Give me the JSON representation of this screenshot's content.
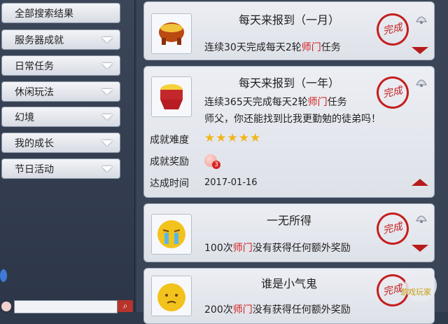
{
  "sidebar": {
    "items": [
      {
        "label": "全部搜索结果"
      },
      {
        "label": "服务器成就"
      },
      {
        "label": "日常任务"
      },
      {
        "label": "休闲玩法"
      },
      {
        "label": "幻境"
      },
      {
        "label": "我的成长"
      },
      {
        "label": "节日活动"
      }
    ],
    "search": {
      "placeholder": "",
      "value": ""
    }
  },
  "cards": [
    {
      "title": "每天来报到（一月）",
      "desc_pre": "连续30天完成每天2轮",
      "desc_red": "师门",
      "desc_post": "任务",
      "stamp": "完成"
    },
    {
      "title": "每天来报到（一年）",
      "desc_pre": "连续365天完成每天2轮",
      "desc_red": "师门",
      "desc_post": "任务",
      "desc2": "师父，你还能找到比我更勤勉的徒弟吗！",
      "stamp": "完成",
      "difficulty_label": "成就难度",
      "difficulty_stars": "★★★★★",
      "reward_label": "成就奖励",
      "reward_count": "3",
      "date_label": "达成时间",
      "date_value": "2017-01-16"
    },
    {
      "title": "一无所得",
      "desc_pre": "100次",
      "desc_red": "师门",
      "desc_post": "没有获得任何额外奖励",
      "stamp": "完成"
    },
    {
      "title": "谁是小气鬼",
      "desc_pre": "200次",
      "desc_red": "师门",
      "desc_post": "没有获得任何额外奖励",
      "stamp": "完成"
    }
  ],
  "watermark": "游戏玩家"
}
